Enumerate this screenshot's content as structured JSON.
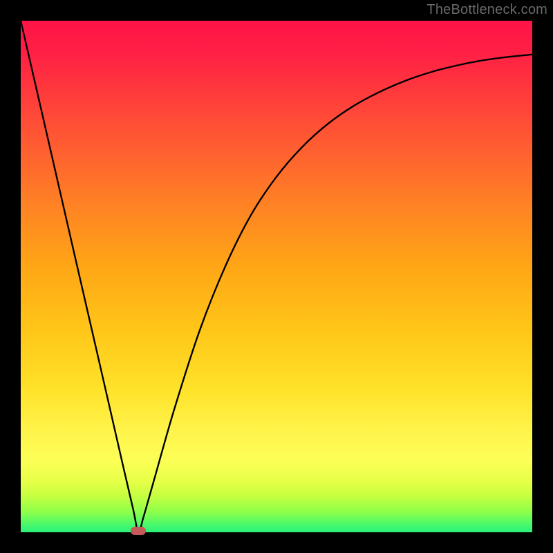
{
  "watermark": "TheBottleneck.com",
  "chart_data": {
    "type": "line",
    "title": "",
    "xlabel": "",
    "ylabel": "",
    "xlim": [
      0,
      1
    ],
    "ylim": [
      0,
      1
    ],
    "grid": false,
    "background_gradient": [
      "#ff1448",
      "#ff8224",
      "#ffe22a",
      "#fcff56",
      "#2af07a"
    ],
    "minimum_point": {
      "x": 0.23,
      "y": 0.0
    },
    "minimum_marker_color": "#c55a5a",
    "series": [
      {
        "name": "bottleneck-curve",
        "color": "#000000",
        "x": [
          0.0,
          0.05,
          0.1,
          0.15,
          0.2,
          0.22,
          0.23,
          0.24,
          0.26,
          0.3,
          0.35,
          0.4,
          0.45,
          0.5,
          0.55,
          0.6,
          0.65,
          0.7,
          0.75,
          0.8,
          0.85,
          0.9,
          0.95,
          1.0
        ],
        "y": [
          1.0,
          0.783,
          0.565,
          0.348,
          0.13,
          0.044,
          0.0,
          0.03,
          0.1,
          0.24,
          0.395,
          0.52,
          0.62,
          0.695,
          0.753,
          0.798,
          0.833,
          0.86,
          0.882,
          0.899,
          0.912,
          0.922,
          0.929,
          0.934
        ]
      }
    ]
  }
}
